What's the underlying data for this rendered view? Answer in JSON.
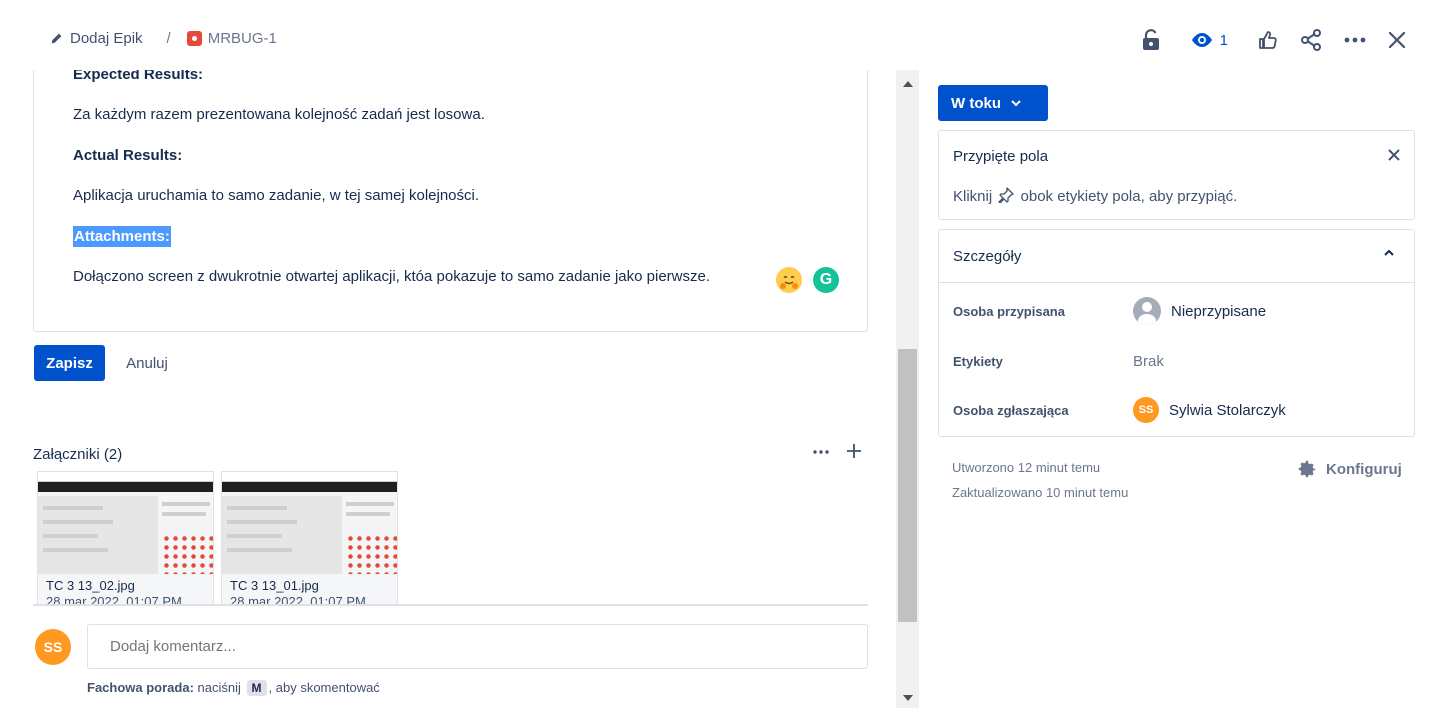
{
  "breadcrumb": {
    "add_epic_label": "Dodaj Epik",
    "separator": "/",
    "issue_key": "MRBUG-1"
  },
  "header_actions": {
    "watchers_count": "1"
  },
  "editor": {
    "expected_heading": "Expected Results:",
    "expected_text": "Za każdym razem prezentowana kolejność zadań jest losowa.",
    "actual_heading": "Actual Results:",
    "actual_text": "Aplikacja uruchamia to samo zadanie, w tej samej kolejności.",
    "attachments_heading": "Attachments:",
    "attachments_text": "Dołączono screen z dwukrotnie otwartej aplikacji, któa pokazuje to samo zadanie jako pierwsze.",
    "grammarly_letter": "G"
  },
  "editor_buttons": {
    "save": "Zapisz",
    "cancel": "Anuluj"
  },
  "attachments": {
    "title": "Załączniki (2)",
    "items": [
      {
        "name": "TC 3 13_02.jpg",
        "date": "28 mar 2022, 01:07 PM"
      },
      {
        "name": "TC 3 13_01.jpg",
        "date": "28 mar 2022, 01:07 PM"
      }
    ]
  },
  "comment": {
    "avatar_initials": "SS",
    "placeholder": "Dodaj komentarz...",
    "tip_bold": "Fachowa porada:",
    "tip_pre": "naciśnij",
    "tip_key": "M",
    "tip_post": ", aby skomentować"
  },
  "status": {
    "label": "W toku"
  },
  "pinned": {
    "title": "Przypięte pola",
    "hint_pre": "Kliknij",
    "hint_post": "obok etykiety pola, aby przypiąć."
  },
  "details": {
    "title": "Szczegóły",
    "assignee_label": "Osoba przypisana",
    "assignee_value": "Nieprzypisane",
    "labels_label": "Etykiety",
    "labels_value": "Brak",
    "reporter_label": "Osoba zgłaszająca",
    "reporter_initials": "SS",
    "reporter_value": "Sylwia Stolarczyk"
  },
  "timestamps": {
    "created": "Utworzono 12 minut temu",
    "updated": "Zaktualizowano 10 minut temu"
  },
  "configure_label": "Konfiguruj",
  "colors": {
    "primary": "#0052cc",
    "avatar": "#ff991f",
    "bug": "#e5493a",
    "grammarly": "#15c39a",
    "highlight": "#4c9aff"
  }
}
